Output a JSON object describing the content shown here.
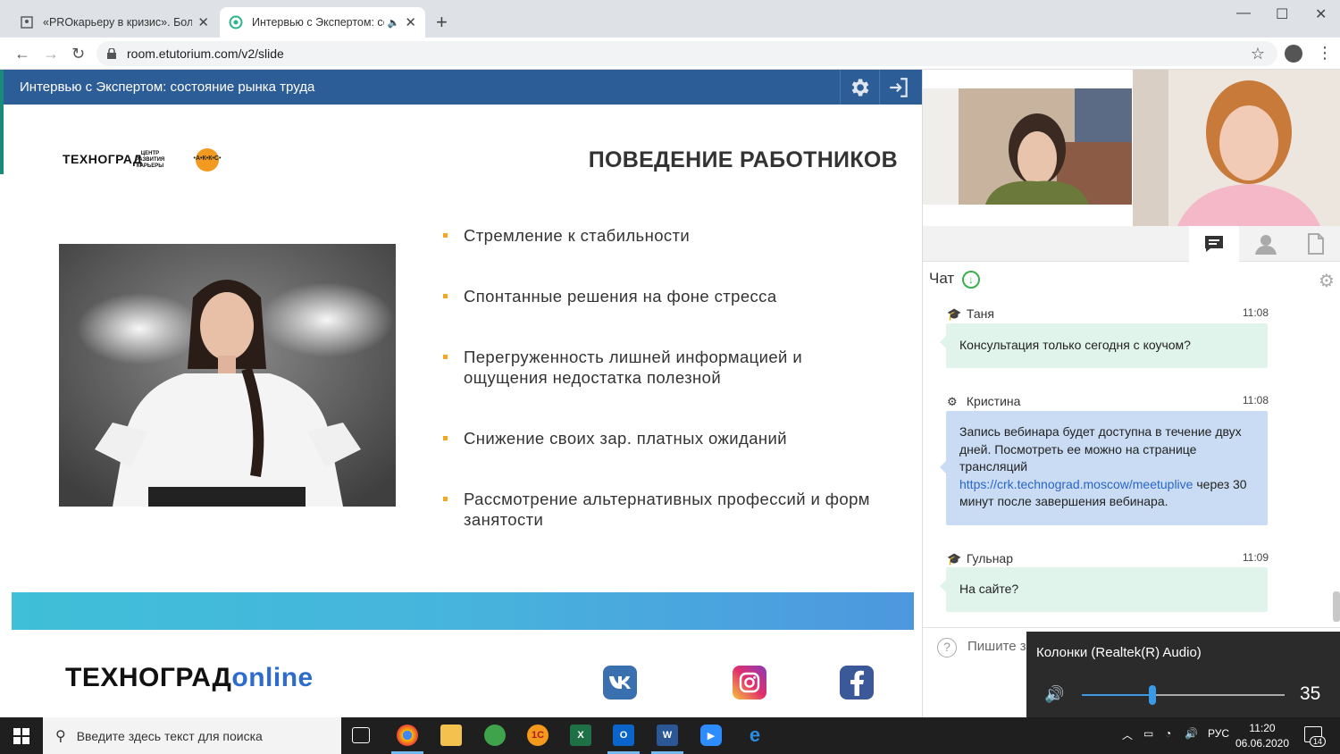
{
  "browser": {
    "tabs": [
      {
        "title": "«PROкарьеру в кризис». Больш",
        "active": false
      },
      {
        "title": "Интервью с Экспертом: сос",
        "active": true
      }
    ],
    "new_tab": "+",
    "url": "room.etutorium.com/v2/slide",
    "window_controls": [
      "—",
      "☐",
      "✕"
    ]
  },
  "webinar": {
    "title": "Интервью с Экспертом: состояние рынка труда",
    "settings_icon": "gear-icon",
    "exit_icon": "exit-icon"
  },
  "slide": {
    "logo_tg": "ТЕХНОГРАД",
    "logo_crk": "ЦЕНТР РАЗВИТИЯ КАРЬЕРЫ",
    "logo_akks": "•А•К•К•С•",
    "title": "ПОВЕДЕНИЕ РАБОТНИКОВ",
    "bullets": [
      "Стремление к стабильности",
      "Спонтанные решения на фоне стресса",
      "Перегруженность лишней информацией и ощущения недостатка полезной",
      "Снижение своих зар. платных ожиданий",
      "Рассмотрение альтернативных профессий и форм занятости"
    ],
    "footer_brand_1": "ТЕХНОГРАД",
    "footer_brand_2": "online",
    "social": [
      "vk-icon",
      "instagram-icon",
      "facebook-icon"
    ],
    "accent": "#f5a623",
    "brand_blue": "#2d5d96"
  },
  "chat": {
    "label": "Чат",
    "messages": [
      {
        "author": "Таня",
        "time": "11:08",
        "text": "Консультация только сегодня с коучом?",
        "role": "student"
      },
      {
        "author": "Кристина",
        "time": "11:08",
        "text_1": "Запись вебинара будет доступна в течение двух дней. Посмотреть ее можно на странице трансляций ",
        "link": "https://crk.technograd.moscow/meetuplive",
        "text_2": " через 30 минут после завершения вебинара.",
        "role": "moderator"
      },
      {
        "author": "Гульнар",
        "time": "11:09",
        "text": "На сайте?",
        "role": "student"
      }
    ],
    "input_placeholder": "Пишите з"
  },
  "volume": {
    "device": "Колонки (Realtek(R) Audio)",
    "level": 35
  },
  "taskbar": {
    "search_placeholder": "Введите здесь текст для поиска",
    "lang": "РУС",
    "time": "11:20",
    "date": "06.06.2020",
    "notifications": "14"
  }
}
